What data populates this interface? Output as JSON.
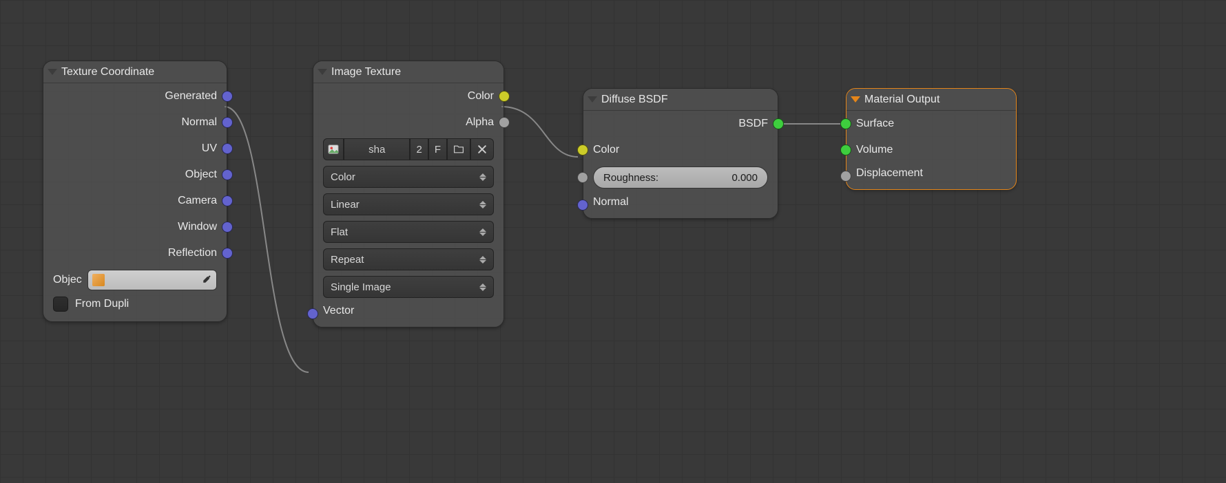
{
  "nodes": {
    "texcoord": {
      "title": "Texture Coordinate",
      "outputs": [
        "Generated",
        "Normal",
        "UV",
        "Object",
        "Camera",
        "Window",
        "Reflection"
      ],
      "object_label": "Objec",
      "from_dupli": "From Dupli"
    },
    "imgtex": {
      "title": "Image Texture",
      "out_color": "Color",
      "out_alpha": "Alpha",
      "img_name": "sha",
      "img_users": "2",
      "img_fake": "F",
      "dd_colorspace": "Color",
      "dd_interp": "Linear",
      "dd_proj": "Flat",
      "dd_ext": "Repeat",
      "dd_source": "Single Image",
      "in_vector": "Vector"
    },
    "diffuse": {
      "title": "Diffuse BSDF",
      "out_bsdf": "BSDF",
      "in_color": "Color",
      "roughness_label": "Roughness:",
      "roughness_value": "0.000",
      "in_normal": "Normal"
    },
    "output": {
      "title": "Material Output",
      "in_surface": "Surface",
      "in_volume": "Volume",
      "in_disp": "Displacement"
    }
  },
  "colors": {
    "vector": "#6363ce",
    "color": "#cccc29",
    "float": "#a1a1a1",
    "shader": "#3ece3e",
    "accent": "#e68619"
  }
}
